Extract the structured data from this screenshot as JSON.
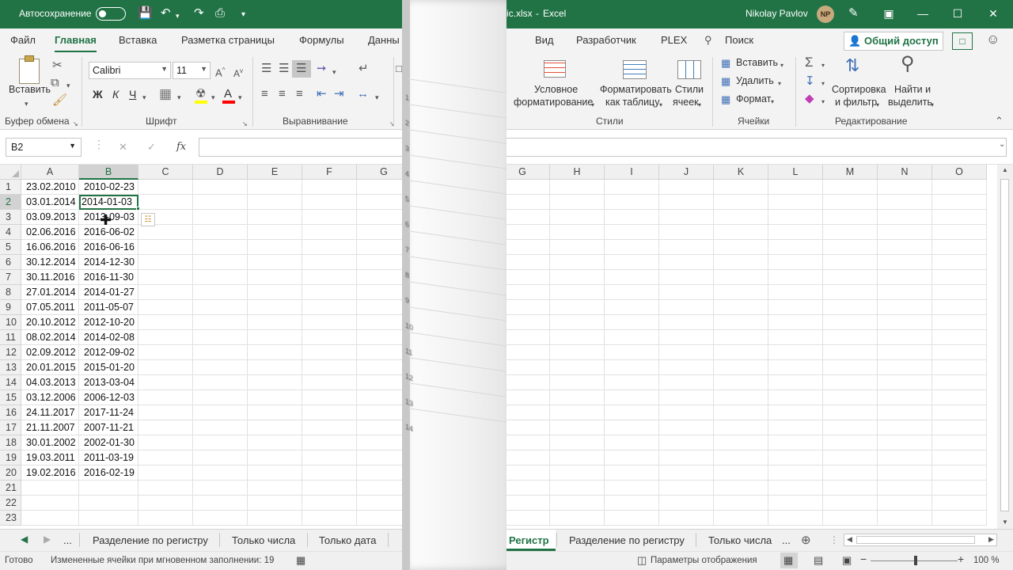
{
  "titlebar": {
    "autosave_label": "Автосохранение",
    "filename": "ic.xlsx",
    "app": "Excel",
    "user": "Nikolay Pavlov",
    "user_initials": "NP"
  },
  "ribbon_tabs": [
    "Файл",
    "Главная",
    "Вставка",
    "Разметка страницы",
    "Формулы",
    "Данны",
    "Вид",
    "Разработчик",
    "PLEX"
  ],
  "search_label": "Поиск",
  "share_label": "Общий доступ",
  "ribbon": {
    "paste": "Вставить",
    "clipboard_group": "Буфер обмена",
    "font_name": "Calibri",
    "font_size": "11",
    "bold": "Ж",
    "italic": "К",
    "underline": "Ч",
    "font_group": "Шрифт",
    "align_group": "Выравнивание",
    "cond_format_1": "Условное",
    "cond_format_2": "форматирование",
    "format_table_1": "Форматировать",
    "format_table_2": "как таблицу",
    "cell_styles_1": "Стили",
    "cell_styles_2": "ячеек",
    "styles_group": "Стили",
    "insert": "Вставить",
    "delete": "Удалить",
    "format": "Формат",
    "cells_group": "Ячейки",
    "sort_1": "Сортировка",
    "sort_2": "и фильтр",
    "find_1": "Найти и",
    "find_2": "выделить",
    "editing_group": "Редактирование"
  },
  "formula_bar": {
    "name_box": "B2",
    "fx": "fx",
    "value": ""
  },
  "columns": [
    "A",
    "B",
    "C",
    "D",
    "E",
    "F",
    "G",
    "G",
    "H",
    "I",
    "J",
    "K",
    "L",
    "M",
    "N",
    "O"
  ],
  "rows": [
    {
      "n": "1",
      "a": "23.02.2010",
      "b": "2010-02-23"
    },
    {
      "n": "2",
      "a": "03.01.2014",
      "b": "2014-01-03"
    },
    {
      "n": "3",
      "a": "03.09.2013",
      "b": "2013-09-03"
    },
    {
      "n": "4",
      "a": "02.06.2016",
      "b": "2016-06-02"
    },
    {
      "n": "5",
      "a": "16.06.2016",
      "b": "2016-06-16"
    },
    {
      "n": "6",
      "a": "30.12.2014",
      "b": "2014-12-30"
    },
    {
      "n": "7",
      "a": "30.11.2016",
      "b": "2016-11-30"
    },
    {
      "n": "8",
      "a": "27.01.2014",
      "b": "2014-01-27"
    },
    {
      "n": "9",
      "a": "07.05.2011",
      "b": "2011-05-07"
    },
    {
      "n": "10",
      "a": "20.10.2012",
      "b": "2012-10-20"
    },
    {
      "n": "11",
      "a": "08.02.2014",
      "b": "2014-02-08"
    },
    {
      "n": "12",
      "a": "02.09.2012",
      "b": "2012-09-02"
    },
    {
      "n": "13",
      "a": "20.01.2015",
      "b": "2015-01-20"
    },
    {
      "n": "14",
      "a": "04.03.2013",
      "b": "2013-03-04"
    },
    {
      "n": "15",
      "a": "03.12.2006",
      "b": "2006-12-03"
    },
    {
      "n": "16",
      "a": "24.11.2017",
      "b": "2017-11-24"
    },
    {
      "n": "17",
      "a": "21.11.2007",
      "b": "2007-11-21"
    },
    {
      "n": "18",
      "a": "30.01.2002",
      "b": "2002-01-30"
    },
    {
      "n": "19",
      "a": "19.03.2011",
      "b": "2011-03-19"
    },
    {
      "n": "20",
      "a": "19.02.2016",
      "b": "2016-02-19"
    },
    {
      "n": "21",
      "a": "",
      "b": ""
    },
    {
      "n": "22",
      "a": "",
      "b": ""
    },
    {
      "n": "23",
      "a": "",
      "b": ""
    }
  ],
  "transition_rows": [
    "1",
    "2",
    "3",
    "4",
    "5",
    "6",
    "7",
    "8",
    "9",
    "10",
    "11",
    "12",
    "13",
    "14"
  ],
  "sheet_tabs_left": [
    "...",
    "Разделение по регистру",
    "Только числа",
    "Только дата"
  ],
  "sheet_tabs_right": [
    "Регистр",
    "Разделение по регистру",
    "Только числа",
    "..."
  ],
  "status": {
    "ready": "Готово",
    "message": "Измененные ячейки при мгновенном заполнении: 19",
    "display_settings": "Параметры отображения",
    "zoom": "100 %"
  },
  "colors": {
    "accent": "#217346",
    "ribbon_bg": "#f3f3f3",
    "header_bg": "#f0f0f0"
  }
}
